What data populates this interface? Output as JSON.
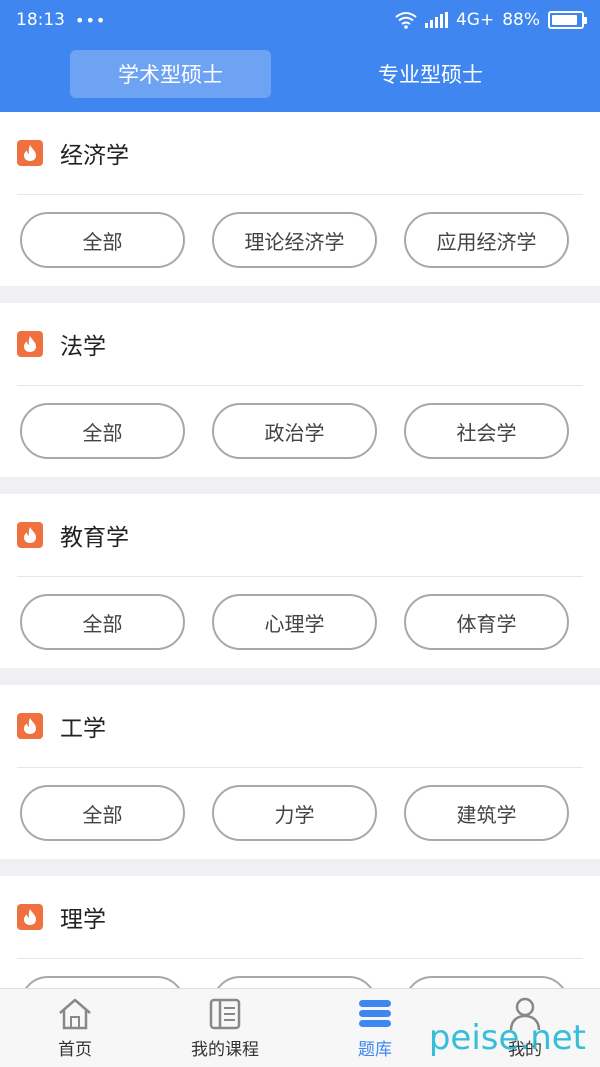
{
  "status": {
    "time": "18:13",
    "dots": "•••",
    "network": "4G+",
    "battery": "88%",
    "battery_level": 0.88
  },
  "tabs": [
    {
      "label": "学术型硕士",
      "active": true
    },
    {
      "label": "专业型硕士",
      "active": false
    }
  ],
  "sections": [
    {
      "title": "经济学",
      "pills": [
        "全部",
        "理论经济学",
        "应用经济学"
      ]
    },
    {
      "title": "法学",
      "pills": [
        "全部",
        "政治学",
        "社会学"
      ]
    },
    {
      "title": "教育学",
      "pills": [
        "全部",
        "心理学",
        "体育学"
      ]
    },
    {
      "title": "工学",
      "pills": [
        "全部",
        "力学",
        "建筑学"
      ]
    },
    {
      "title": "理学",
      "pills": [
        "",
        "",
        ""
      ]
    }
  ],
  "nav": [
    {
      "label": "首页",
      "icon": "home-icon"
    },
    {
      "label": "我的课程",
      "icon": "courses-icon"
    },
    {
      "label": "题库",
      "icon": "question-bank-icon"
    },
    {
      "label": "我的",
      "icon": "profile-icon"
    }
  ],
  "watermark": "peise.net",
  "colors": {
    "primary": "#3f86f0",
    "accent": "#f07140"
  }
}
